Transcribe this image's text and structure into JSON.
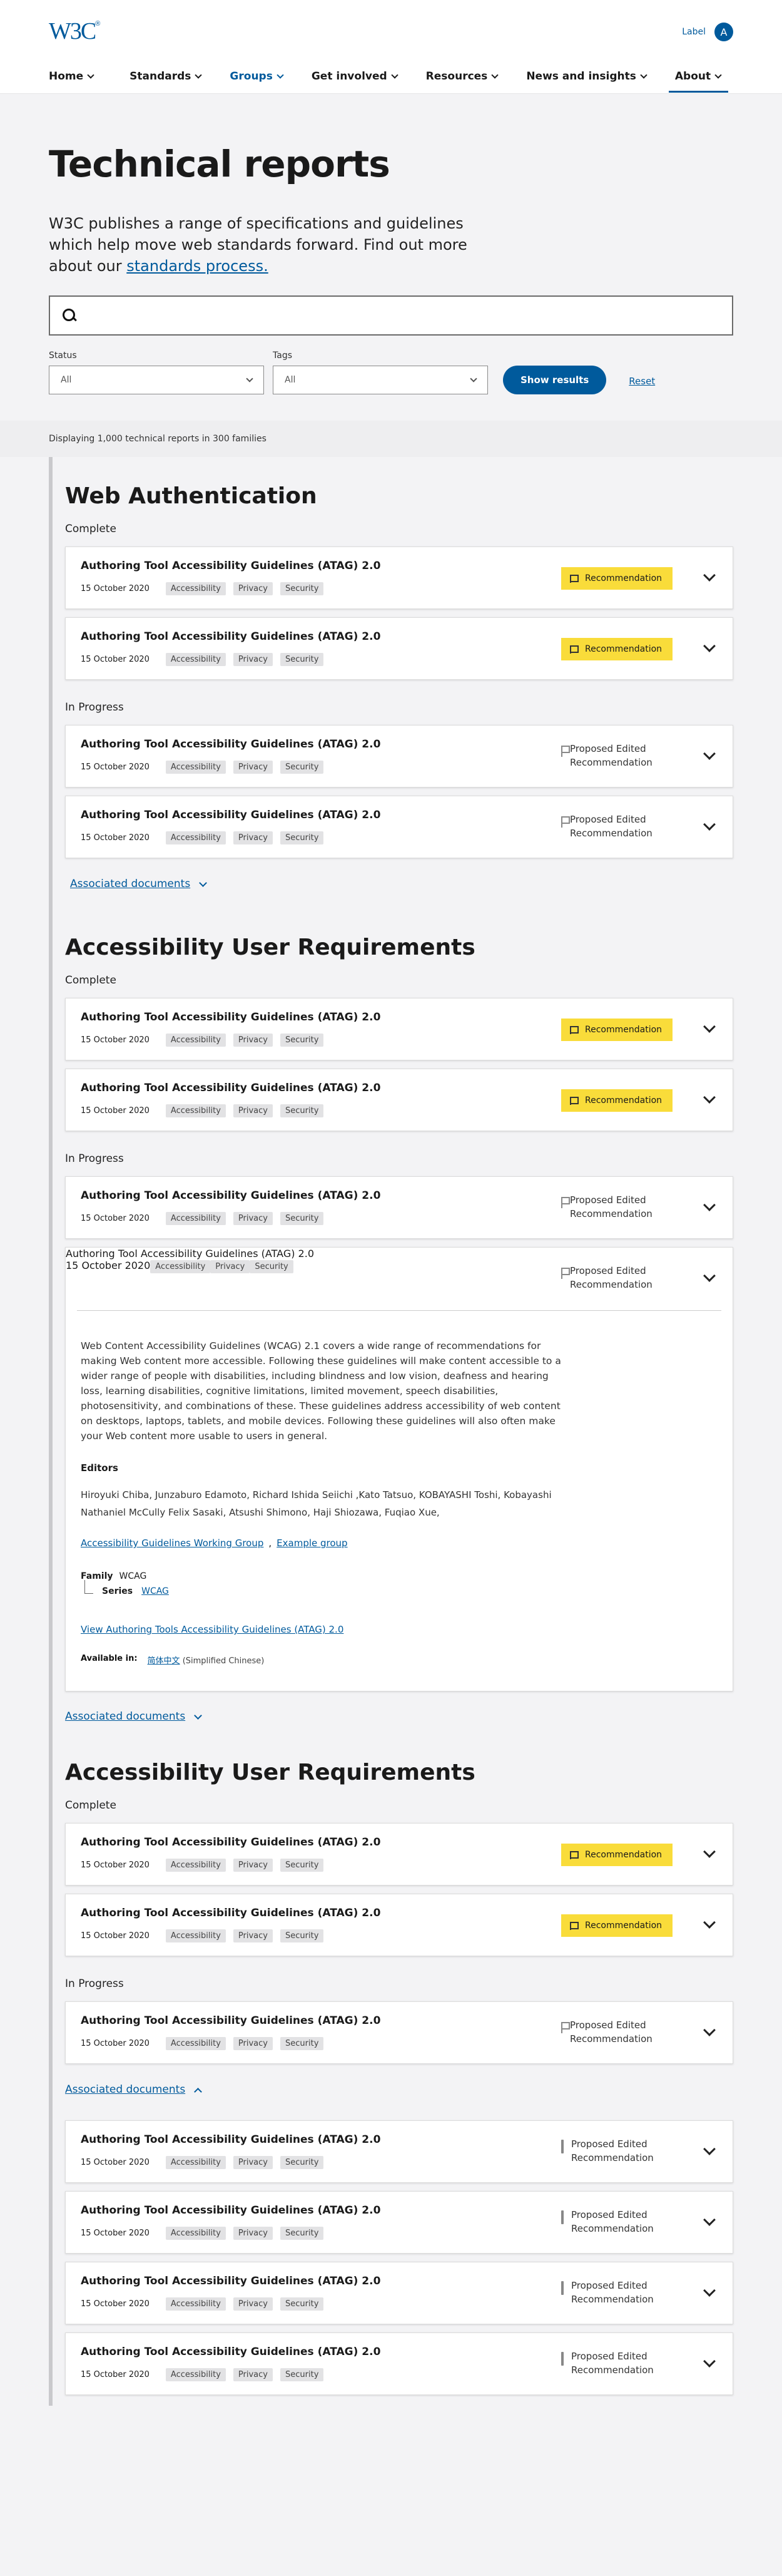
{
  "header": {
    "logo": "W3C",
    "logo_mark": "®",
    "account_label": "Label",
    "avatar_letter": "A",
    "nav": [
      "Home",
      "Standards",
      "Groups",
      "Get involved",
      "Resources",
      "News and insights",
      "About"
    ]
  },
  "hero": {
    "title": "Technical reports",
    "lead": "W3C publishes a range of specifications and guidelines which help move web standards forward. Find out more about our ",
    "lead_link": "standards process.",
    "search_placeholder": "",
    "status_label": "Status",
    "status_value": "All",
    "tags_label": "Tags",
    "tags_value": "All",
    "show_results": "Show results",
    "reset": "Reset"
  },
  "displaying": "Displaying 1,000 technical reports in 300 families",
  "card": {
    "title": "Authoring Tool Accessibility Guidelines (ATAG) 2.0",
    "date": "15 October 2020",
    "tags": [
      "Accessibility",
      "Privacy",
      "Security"
    ],
    "recommendation": "Recommendation",
    "proposed_l1": "Proposed Edited",
    "proposed_l2": "Recommendation"
  },
  "sections": {
    "complete": "Complete",
    "in_progress": "In Progress",
    "associated": "Associated documents"
  },
  "families": [
    "Web Authentication",
    "Accessibility User Requirements",
    "Accessibility User Requirements"
  ],
  "detail": {
    "description": "Web Content Accessibility Guidelines (WCAG) 2.1 covers a wide range of recommendations for making Web content more accessible. Following these guidelines will make content accessible to a wider range of people with disabilities, including blindness and low vision, deafness and hearing loss, learning disabilities, cognitive limitations, limited movement, speech disabilities, photosensitivity, and combinations of these. These guidelines address accessibility of web content on desktops, laptops, tablets, and mobile devices. Following these guidelines will also often make your Web content more usable to users in general.",
    "editors_label": "Editors",
    "editors": "Hiroyuki Chiba, Junzaburo Edamoto, Richard Ishida Seiichi ,Kato Tatsuo, KOBAYASHI Toshi, Kobayashi Nathaniel McCully Felix Sasaki, Atsushi Shimono, Haji Shiozawa, Fuqiao Xue,",
    "group1": "Accessibility Guidelines Working Group",
    "sep": ",",
    "group2": "Example group",
    "family_label": "Family",
    "family_value": "WCAG",
    "series_label": "Series",
    "series_value": "WCAG",
    "view_link": "View Authoring Tools Accessibility Guidelines (ATAG) 2.0",
    "available_label": "Available in:",
    "available_lang": "简体中文",
    "available_lang_note": "(Simplified Chinese)"
  }
}
